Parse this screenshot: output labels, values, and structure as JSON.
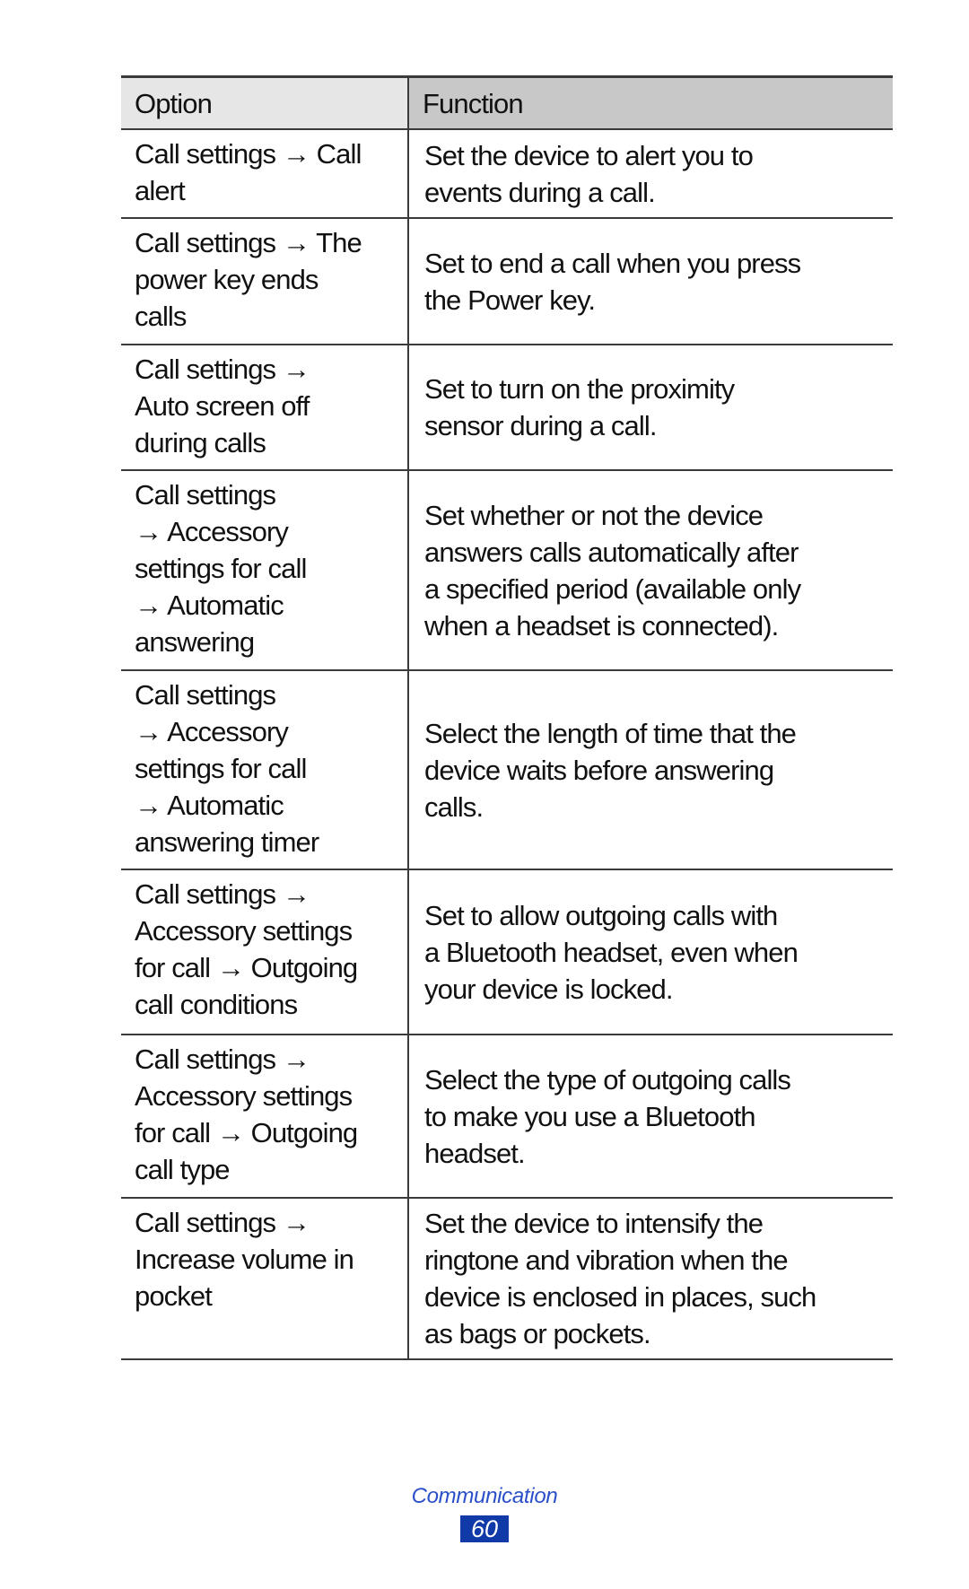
{
  "table": {
    "headers": [
      "Option",
      "Function"
    ],
    "header_colors": {
      "option": "#e6e6e6",
      "function": "#c8c8c8"
    },
    "rows": [
      {
        "option": [
          "Call settings → Call",
          "alert"
        ],
        "function": [
          "Set the device to alert you to",
          "events during a call."
        ]
      },
      {
        "option": [
          "Call settings → The",
          "power key ends",
          "calls"
        ],
        "function": [
          "Set to end a call when you press",
          "the Power key."
        ]
      },
      {
        "option": [
          "Call settings →",
          "Auto screen off",
          "during calls"
        ],
        "function": [
          "Set to turn on the proximity",
          "sensor during a call."
        ]
      },
      {
        "option": [
          "Call settings",
          "→ Accessory",
          "settings for call",
          "→ Automatic",
          "answering"
        ],
        "function": [
          "Set whether or not the device",
          "answers calls automatically after",
          "a specified period (available only",
          "when a headset is connected)."
        ]
      },
      {
        "option": [
          "Call settings",
          "→ Accessory",
          "settings for call",
          "→ Automatic",
          "answering timer"
        ],
        "function": [
          "Select the length of time that the",
          "device waits before answering",
          "calls."
        ]
      },
      {
        "option": [
          "Call settings →",
          "Accessory settings",
          "for call → Outgoing",
          "call conditions"
        ],
        "function": [
          "Set to allow outgoing calls with",
          "a Bluetooth headset, even when",
          "your device is locked."
        ]
      },
      {
        "option": [
          "Call settings →",
          "Accessory settings",
          "for call → Outgoing",
          "call type"
        ],
        "function": [
          "Select the type of outgoing calls",
          "to make you use a Bluetooth",
          "headset."
        ]
      },
      {
        "option": [
          "Call settings →",
          "Increase volume in",
          "pocket"
        ],
        "function": [
          "Set the device to intensify the",
          "ringtone and vibration when the",
          "device is enclosed in places, such",
          "as bags or pockets."
        ]
      }
    ]
  },
  "footer": {
    "section": "Communication",
    "page_number": "60",
    "accent_color": "#2a4fc8",
    "page_box_color": "#0f3aa8"
  }
}
